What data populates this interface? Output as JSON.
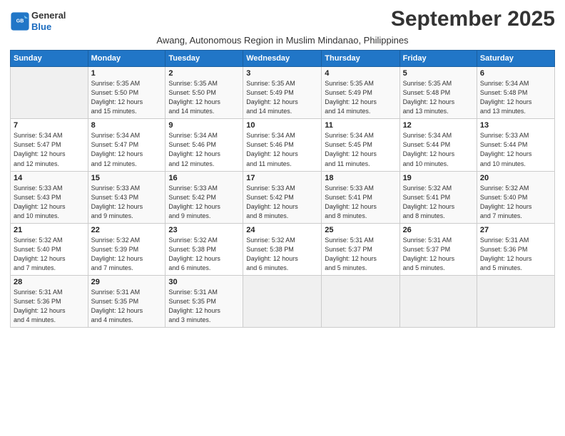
{
  "logo": {
    "line1": "General",
    "line2": "Blue"
  },
  "title": "September 2025",
  "subtitle": "Awang, Autonomous Region in Muslim Mindanao, Philippines",
  "days_of_week": [
    "Sunday",
    "Monday",
    "Tuesday",
    "Wednesday",
    "Thursday",
    "Friday",
    "Saturday"
  ],
  "weeks": [
    [
      {
        "num": "",
        "info": ""
      },
      {
        "num": "1",
        "info": "Sunrise: 5:35 AM\nSunset: 5:50 PM\nDaylight: 12 hours\nand 15 minutes."
      },
      {
        "num": "2",
        "info": "Sunrise: 5:35 AM\nSunset: 5:50 PM\nDaylight: 12 hours\nand 14 minutes."
      },
      {
        "num": "3",
        "info": "Sunrise: 5:35 AM\nSunset: 5:49 PM\nDaylight: 12 hours\nand 14 minutes."
      },
      {
        "num": "4",
        "info": "Sunrise: 5:35 AM\nSunset: 5:49 PM\nDaylight: 12 hours\nand 14 minutes."
      },
      {
        "num": "5",
        "info": "Sunrise: 5:35 AM\nSunset: 5:48 PM\nDaylight: 12 hours\nand 13 minutes."
      },
      {
        "num": "6",
        "info": "Sunrise: 5:34 AM\nSunset: 5:48 PM\nDaylight: 12 hours\nand 13 minutes."
      }
    ],
    [
      {
        "num": "7",
        "info": "Sunrise: 5:34 AM\nSunset: 5:47 PM\nDaylight: 12 hours\nand 12 minutes."
      },
      {
        "num": "8",
        "info": "Sunrise: 5:34 AM\nSunset: 5:47 PM\nDaylight: 12 hours\nand 12 minutes."
      },
      {
        "num": "9",
        "info": "Sunrise: 5:34 AM\nSunset: 5:46 PM\nDaylight: 12 hours\nand 12 minutes."
      },
      {
        "num": "10",
        "info": "Sunrise: 5:34 AM\nSunset: 5:46 PM\nDaylight: 12 hours\nand 11 minutes."
      },
      {
        "num": "11",
        "info": "Sunrise: 5:34 AM\nSunset: 5:45 PM\nDaylight: 12 hours\nand 11 minutes."
      },
      {
        "num": "12",
        "info": "Sunrise: 5:34 AM\nSunset: 5:44 PM\nDaylight: 12 hours\nand 10 minutes."
      },
      {
        "num": "13",
        "info": "Sunrise: 5:33 AM\nSunset: 5:44 PM\nDaylight: 12 hours\nand 10 minutes."
      }
    ],
    [
      {
        "num": "14",
        "info": "Sunrise: 5:33 AM\nSunset: 5:43 PM\nDaylight: 12 hours\nand 10 minutes."
      },
      {
        "num": "15",
        "info": "Sunrise: 5:33 AM\nSunset: 5:43 PM\nDaylight: 12 hours\nand 9 minutes."
      },
      {
        "num": "16",
        "info": "Sunrise: 5:33 AM\nSunset: 5:42 PM\nDaylight: 12 hours\nand 9 minutes."
      },
      {
        "num": "17",
        "info": "Sunrise: 5:33 AM\nSunset: 5:42 PM\nDaylight: 12 hours\nand 8 minutes."
      },
      {
        "num": "18",
        "info": "Sunrise: 5:33 AM\nSunset: 5:41 PM\nDaylight: 12 hours\nand 8 minutes."
      },
      {
        "num": "19",
        "info": "Sunrise: 5:32 AM\nSunset: 5:41 PM\nDaylight: 12 hours\nand 8 minutes."
      },
      {
        "num": "20",
        "info": "Sunrise: 5:32 AM\nSunset: 5:40 PM\nDaylight: 12 hours\nand 7 minutes."
      }
    ],
    [
      {
        "num": "21",
        "info": "Sunrise: 5:32 AM\nSunset: 5:40 PM\nDaylight: 12 hours\nand 7 minutes."
      },
      {
        "num": "22",
        "info": "Sunrise: 5:32 AM\nSunset: 5:39 PM\nDaylight: 12 hours\nand 7 minutes."
      },
      {
        "num": "23",
        "info": "Sunrise: 5:32 AM\nSunset: 5:38 PM\nDaylight: 12 hours\nand 6 minutes."
      },
      {
        "num": "24",
        "info": "Sunrise: 5:32 AM\nSunset: 5:38 PM\nDaylight: 12 hours\nand 6 minutes."
      },
      {
        "num": "25",
        "info": "Sunrise: 5:31 AM\nSunset: 5:37 PM\nDaylight: 12 hours\nand 5 minutes."
      },
      {
        "num": "26",
        "info": "Sunrise: 5:31 AM\nSunset: 5:37 PM\nDaylight: 12 hours\nand 5 minutes."
      },
      {
        "num": "27",
        "info": "Sunrise: 5:31 AM\nSunset: 5:36 PM\nDaylight: 12 hours\nand 5 minutes."
      }
    ],
    [
      {
        "num": "28",
        "info": "Sunrise: 5:31 AM\nSunset: 5:36 PM\nDaylight: 12 hours\nand 4 minutes."
      },
      {
        "num": "29",
        "info": "Sunrise: 5:31 AM\nSunset: 5:35 PM\nDaylight: 12 hours\nand 4 minutes."
      },
      {
        "num": "30",
        "info": "Sunrise: 5:31 AM\nSunset: 5:35 PM\nDaylight: 12 hours\nand 3 minutes."
      },
      {
        "num": "",
        "info": ""
      },
      {
        "num": "",
        "info": ""
      },
      {
        "num": "",
        "info": ""
      },
      {
        "num": "",
        "info": ""
      }
    ]
  ]
}
